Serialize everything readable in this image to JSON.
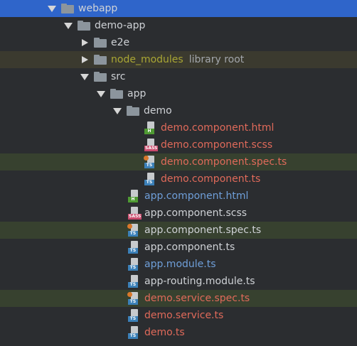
{
  "tree": [
    {
      "label": "webapp",
      "kind": "folder",
      "arrow": "expanded",
      "depth": 0,
      "color": "white",
      "state": "selected"
    },
    {
      "label": "demo-app",
      "kind": "folder",
      "arrow": "expanded",
      "depth": 1,
      "color": "white"
    },
    {
      "label": "e2e",
      "kind": "folder",
      "arrow": "collapsed",
      "depth": 2,
      "color": "white"
    },
    {
      "label": "node_modules",
      "kind": "folder",
      "arrow": "collapsed",
      "depth": 2,
      "color": "olive",
      "extra": "library root",
      "state": "hl-lib"
    },
    {
      "label": "src",
      "kind": "folder",
      "arrow": "expanded",
      "depth": 2,
      "color": "white"
    },
    {
      "label": "app",
      "kind": "folder",
      "arrow": "expanded",
      "depth": 3,
      "color": "white"
    },
    {
      "label": "demo",
      "kind": "folder",
      "arrow": "expanded",
      "depth": 4,
      "color": "white"
    },
    {
      "label": "demo.component.html",
      "kind": "file",
      "badge": "H",
      "badge_type": "html",
      "depth": 5,
      "color": "red"
    },
    {
      "label": "demo.component.scss",
      "kind": "file",
      "badge": "SASS",
      "badge_type": "sass",
      "depth": 5,
      "color": "red"
    },
    {
      "label": "demo.component.spec.ts",
      "kind": "file",
      "badge": "TS",
      "badge_type": "ts",
      "spec": true,
      "depth": 5,
      "color": "red",
      "state": "hl-test"
    },
    {
      "label": "demo.component.ts",
      "kind": "file",
      "badge": "TS",
      "badge_type": "ts",
      "depth": 5,
      "color": "red"
    },
    {
      "label": "app.component.html",
      "kind": "file",
      "badge": "H",
      "badge_type": "html",
      "depth": 4,
      "color": "blue"
    },
    {
      "label": "app.component.scss",
      "kind": "file",
      "badge": "SASS",
      "badge_type": "sass",
      "depth": 4,
      "color": "white"
    },
    {
      "label": "app.component.spec.ts",
      "kind": "file",
      "badge": "TS",
      "badge_type": "ts",
      "spec": true,
      "depth": 4,
      "color": "white",
      "state": "hl-test"
    },
    {
      "label": "app.component.ts",
      "kind": "file",
      "badge": "TS",
      "badge_type": "ts",
      "depth": 4,
      "color": "white"
    },
    {
      "label": "app.module.ts",
      "kind": "file",
      "badge": "TS",
      "badge_type": "ts",
      "depth": 4,
      "color": "blue"
    },
    {
      "label": "app-routing.module.ts",
      "kind": "file",
      "badge": "TS",
      "badge_type": "ts",
      "depth": 4,
      "color": "white"
    },
    {
      "label": "demo.service.spec.ts",
      "kind": "file",
      "badge": "TS",
      "badge_type": "ts",
      "spec": true,
      "depth": 4,
      "color": "red",
      "state": "hl-test"
    },
    {
      "label": "demo.service.ts",
      "kind": "file",
      "badge": "TS",
      "badge_type": "ts",
      "depth": 4,
      "color": "red"
    },
    {
      "label": "demo.ts",
      "kind": "file",
      "badge": "TS",
      "badge_type": "ts",
      "depth": 4,
      "color": "red"
    }
  ],
  "colors": {
    "background": "#2b2d30",
    "selected": "#2f65ca",
    "library_highlight": "#3b3a2f",
    "test_highlight": "#37412f",
    "modified_red": "#e06a5a",
    "added_blue": "#6f9fd9",
    "library_olive": "#a9a634"
  }
}
